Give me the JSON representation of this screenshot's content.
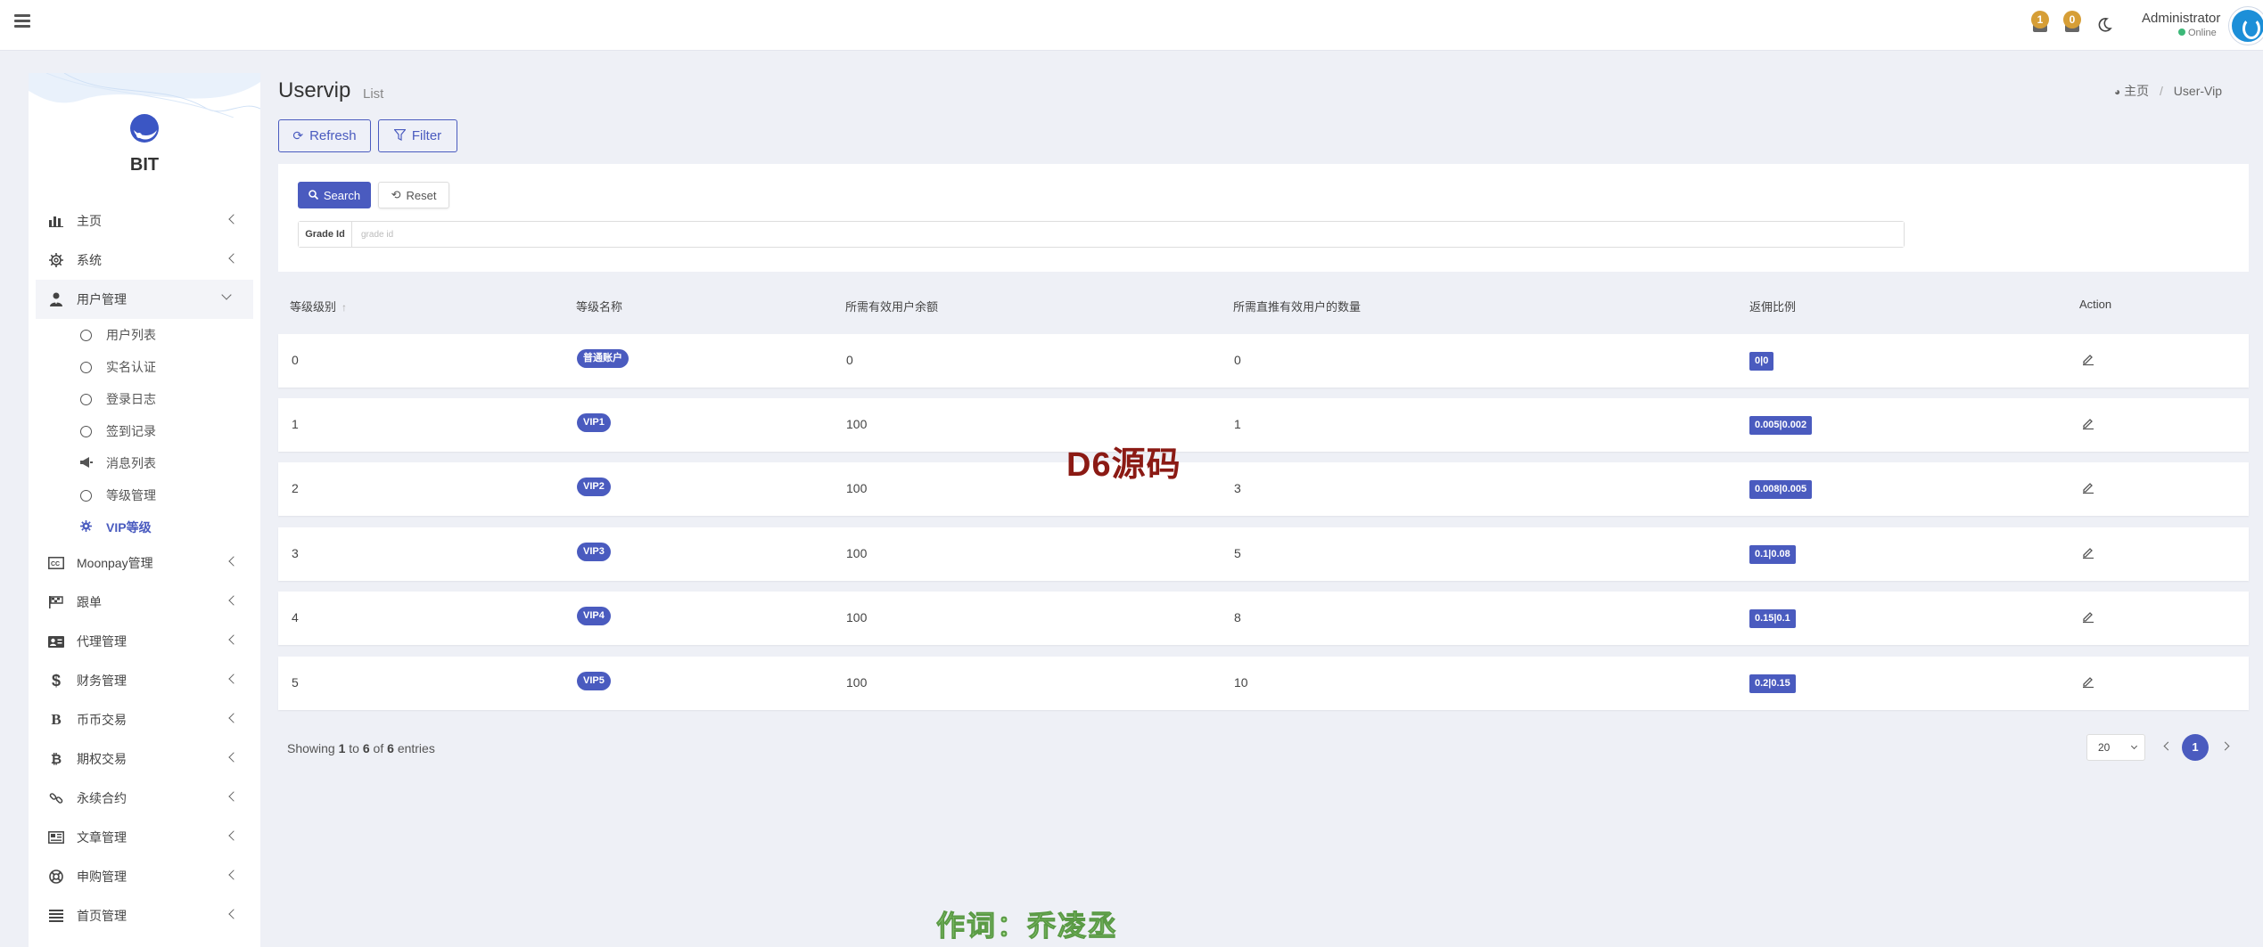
{
  "header": {
    "notifications": [
      {
        "count": "1"
      },
      {
        "count": "0"
      }
    ],
    "user_name": "Administrator",
    "user_status": "Online"
  },
  "sidebar": {
    "logo_text": "BIT",
    "items": [
      {
        "label": "主页",
        "icon": "bar-chart-icon"
      },
      {
        "label": "系统",
        "icon": "gear-icon"
      },
      {
        "label": "用户管理",
        "icon": "user-tie-icon"
      },
      {
        "label": "Moonpay管理",
        "icon": "cc-icon"
      },
      {
        "label": "跟单",
        "icon": "flag-icon"
      },
      {
        "label": "代理管理",
        "icon": "id-card-icon"
      },
      {
        "label": "财务管理",
        "icon": "dollar-icon"
      },
      {
        "label": "币币交易",
        "icon": "bold-b-icon"
      },
      {
        "label": "期权交易",
        "icon": "bitcoin-icon"
      },
      {
        "label": "永续合约",
        "icon": "link-icon"
      },
      {
        "label": "文章管理",
        "icon": "newspaper-icon"
      },
      {
        "label": "申购管理",
        "icon": "lifebuoy-icon"
      },
      {
        "label": "首页管理",
        "icon": "list-icon"
      }
    ],
    "sub_items": [
      {
        "label": "用户列表",
        "icon": "circle-icon"
      },
      {
        "label": "实名认证",
        "icon": "circle-icon"
      },
      {
        "label": "登录日志",
        "icon": "circle-icon"
      },
      {
        "label": "签到记录",
        "icon": "circle-icon"
      },
      {
        "label": "消息列表",
        "icon": "megaphone-icon"
      },
      {
        "label": "等级管理",
        "icon": "circle-icon"
      },
      {
        "label": "VIP等级",
        "icon": "gear-icon"
      }
    ]
  },
  "page": {
    "title": "Uservip",
    "subtitle": "List",
    "breadcrumb": {
      "home": "主页",
      "current": "User-Vip"
    }
  },
  "toolbar": {
    "refresh_label": "Refresh",
    "filter_label": "Filter"
  },
  "filter": {
    "search_label": "Search",
    "reset_label": "Reset",
    "field_label": "Grade Id",
    "field_placeholder": "grade id",
    "field_value": ""
  },
  "table": {
    "columns": [
      "等级级别",
      "等级名称",
      "所需有效用户余额",
      "所需直推有效用户的数量",
      "返佣比例",
      "Action"
    ],
    "rows": [
      {
        "level": "0",
        "name": "普通账户",
        "balance": "0",
        "direct_count": "0",
        "ratio": "0|0"
      },
      {
        "level": "1",
        "name": "VIP1",
        "balance": "100",
        "direct_count": "1",
        "ratio": "0.005|0.002"
      },
      {
        "level": "2",
        "name": "VIP2",
        "balance": "100",
        "direct_count": "3",
        "ratio": "0.008|0.005"
      },
      {
        "level": "3",
        "name": "VIP3",
        "balance": "100",
        "direct_count": "5",
        "ratio": "0.1|0.08"
      },
      {
        "level": "4",
        "name": "VIP4",
        "balance": "100",
        "direct_count": "8",
        "ratio": "0.15|0.1"
      },
      {
        "level": "5",
        "name": "VIP5",
        "balance": "100",
        "direct_count": "10",
        "ratio": "0.2|0.15"
      }
    ]
  },
  "pagination": {
    "showing_prefix": "Showing",
    "from": "1",
    "to_word": "to",
    "to": "6",
    "of_word": "of",
    "total": "6",
    "entries_word": "entries",
    "page_size": "20",
    "current_page": "1"
  },
  "overlay": {
    "watermark": "D6源码",
    "caption": "作词：乔凌丞"
  },
  "colors": {
    "accent": "#4a5bbf",
    "badge": "#d69e36",
    "online": "#3cb878"
  }
}
